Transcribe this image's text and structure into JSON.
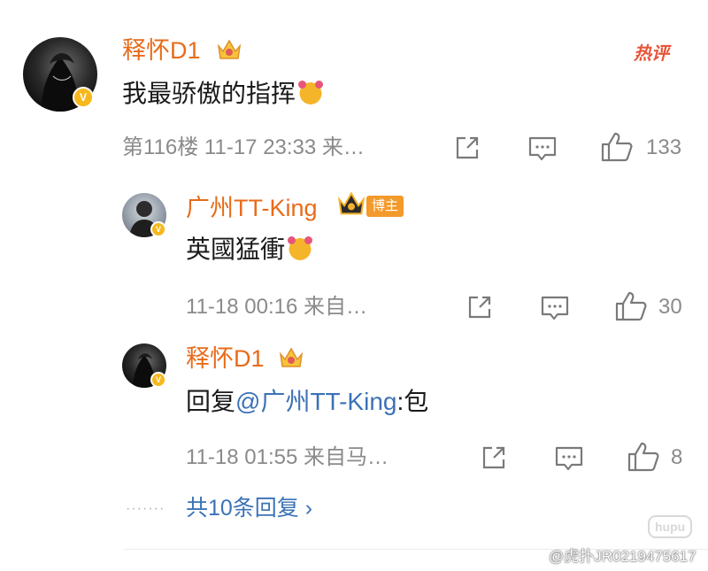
{
  "comment": {
    "user": "释怀D1",
    "text": "我最骄傲的指挥",
    "hot_tag": "热评",
    "meta": "第116楼  11-17 23:33  来…",
    "likes": "133"
  },
  "replies": [
    {
      "user": "广州TT-King",
      "badge": "博主",
      "text": "英國猛衝",
      "meta": "11-18 00:16  来自…",
      "likes": "30"
    },
    {
      "user": "释怀D1",
      "reply_prefix": "回复",
      "mention": "@广州TT-King",
      "reply_rest": ":包",
      "meta": "11-18 01:55  来自马…",
      "likes": "8"
    }
  ],
  "more_replies": {
    "dots": "·······",
    "label": "共10条回复 ›"
  },
  "watermark": {
    "text": "@虎扑JR0219475617",
    "logo": "hupu"
  },
  "colors": {
    "username": "#e86b1a",
    "link": "#3c72b6",
    "meta": "#8a8a8a",
    "hot": "#e8543a",
    "verified": "#f6b81c"
  },
  "icons": [
    "share-icon",
    "comment-icon",
    "like-icon",
    "verified-icon",
    "crown-icon",
    "emoji-icon"
  ]
}
